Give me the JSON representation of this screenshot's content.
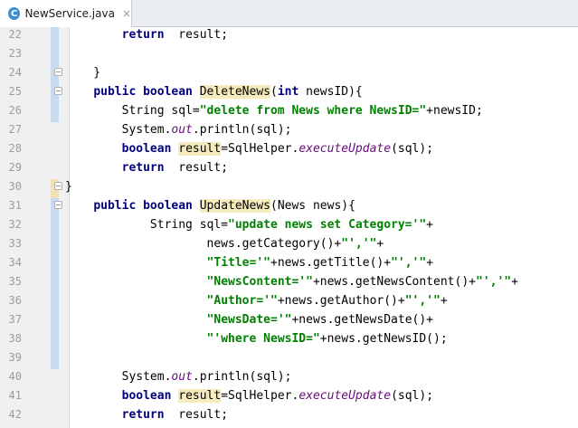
{
  "tab": {
    "icon": "C",
    "title": "NewService.java",
    "close": "×"
  },
  "lines": [
    {
      "n": "22",
      "segs": [
        {
          "t": "        "
        },
        {
          "t": "return",
          "c": "kw"
        },
        {
          "t": "  result;"
        }
      ]
    },
    {
      "n": "23",
      "segs": []
    },
    {
      "n": "24",
      "segs": [
        {
          "t": "    }"
        }
      ]
    },
    {
      "n": "25",
      "segs": [
        {
          "t": "    "
        },
        {
          "t": "public boolean",
          "c": "kw"
        },
        {
          "t": " "
        },
        {
          "t": "DeleteNews",
          "c": "hl"
        },
        {
          "t": "("
        },
        {
          "t": "int",
          "c": "kw"
        },
        {
          "t": " newsID){"
        }
      ]
    },
    {
      "n": "26",
      "segs": [
        {
          "t": "        String sql="
        },
        {
          "t": "\"delete from News where NewsID=\"",
          "c": "str"
        },
        {
          "t": "+newsID;"
        }
      ]
    },
    {
      "n": "27",
      "segs": [
        {
          "t": "        System."
        },
        {
          "t": "out",
          "c": "static"
        },
        {
          "t": ".println(sql);"
        }
      ]
    },
    {
      "n": "28",
      "segs": [
        {
          "t": "        "
        },
        {
          "t": "boolean",
          "c": "kw"
        },
        {
          "t": " "
        },
        {
          "t": "result",
          "c": "hl"
        },
        {
          "t": "=SqlHelper."
        },
        {
          "t": "executeUpdate",
          "c": "static"
        },
        {
          "t": "(sql);"
        }
      ]
    },
    {
      "n": "29",
      "segs": [
        {
          "t": "        "
        },
        {
          "t": "return",
          "c": "kw"
        },
        {
          "t": "  result;"
        }
      ]
    },
    {
      "n": "30",
      "segs": [
        {
          "t": "}"
        }
      ]
    },
    {
      "n": "31",
      "segs": [
        {
          "t": "    "
        },
        {
          "t": "public boolean",
          "c": "kw"
        },
        {
          "t": " "
        },
        {
          "t": "UpdateNews",
          "c": "hl"
        },
        {
          "t": "(News news){"
        }
      ]
    },
    {
      "n": "32",
      "segs": [
        {
          "t": "            String sql="
        },
        {
          "t": "\"update news set Category='\"",
          "c": "str"
        },
        {
          "t": "+"
        }
      ]
    },
    {
      "n": "33",
      "segs": [
        {
          "t": "                    news.getCategory()+"
        },
        {
          "t": "\"','\"",
          "c": "str"
        },
        {
          "t": "+"
        }
      ]
    },
    {
      "n": "34",
      "segs": [
        {
          "t": "                    "
        },
        {
          "t": "\"Title='\"",
          "c": "str"
        },
        {
          "t": "+news.getTitle()+"
        },
        {
          "t": "\"','\"",
          "c": "str"
        },
        {
          "t": "+"
        }
      ]
    },
    {
      "n": "35",
      "segs": [
        {
          "t": "                    "
        },
        {
          "t": "\"NewsContent='\"",
          "c": "str"
        },
        {
          "t": "+news.getNewsContent()+"
        },
        {
          "t": "\"','\"",
          "c": "str"
        },
        {
          "t": "+"
        }
      ]
    },
    {
      "n": "36",
      "segs": [
        {
          "t": "                    "
        },
        {
          "t": "\"Author='\"",
          "c": "str"
        },
        {
          "t": "+news.getAuthor()+"
        },
        {
          "t": "\"','\"",
          "c": "str"
        },
        {
          "t": "+"
        }
      ]
    },
    {
      "n": "37",
      "segs": [
        {
          "t": "                    "
        },
        {
          "t": "\"NewsDate='\"",
          "c": "str"
        },
        {
          "t": "+news.getNewsDate()+"
        }
      ]
    },
    {
      "n": "38",
      "segs": [
        {
          "t": "                    "
        },
        {
          "t": "\"'where NewsID=\"",
          "c": "str"
        },
        {
          "t": "+news.getNewsID();"
        }
      ]
    },
    {
      "n": "39",
      "segs": []
    },
    {
      "n": "40",
      "segs": [
        {
          "t": "        System."
        },
        {
          "t": "out",
          "c": "static"
        },
        {
          "t": ".println(sql);"
        }
      ]
    },
    {
      "n": "41",
      "segs": [
        {
          "t": "        "
        },
        {
          "t": "boolean",
          "c": "kw"
        },
        {
          "t": " "
        },
        {
          "t": "result",
          "c": "hl"
        },
        {
          "t": "=SqlHelper."
        },
        {
          "t": "executeUpdate",
          "c": "static"
        },
        {
          "t": "(sql);"
        }
      ]
    },
    {
      "n": "42",
      "segs": [
        {
          "t": "        "
        },
        {
          "t": "return",
          "c": "kw"
        },
        {
          "t": "  result;"
        }
      ]
    }
  ],
  "fold_markers": [
    "24",
    "25",
    "30",
    "31"
  ],
  "colors": {
    "keyword": "#000080",
    "string": "#008000",
    "static_italic": "#660e7a",
    "usage_highlight": "#f6ebbc",
    "change_marker": "#c6dbef",
    "warning_marker": "#f3e2b5"
  }
}
